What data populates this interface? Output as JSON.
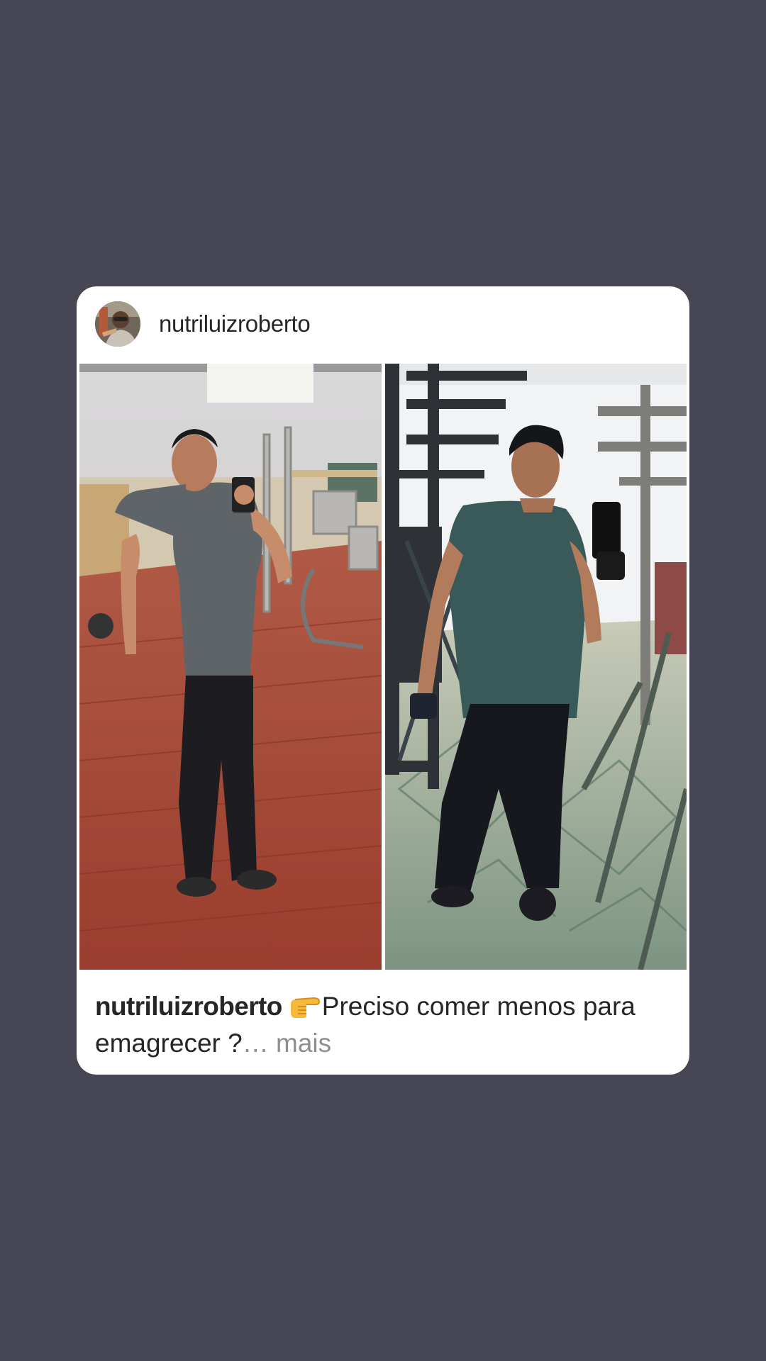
{
  "post": {
    "username": "nutriluizroberto",
    "avatar_icon": "profile-avatar",
    "media": {
      "before_photo_icon": "before-photo",
      "after_photo_icon": "after-photo"
    },
    "caption": {
      "username": "nutriluizroberto",
      "emoji": "pointing-right-icon",
      "text": "Preciso comer menos para emagrecer ?",
      "ellipsis": "…",
      "more_label": " mais"
    }
  },
  "colors": {
    "background": "#474654",
    "card": "#ffffff",
    "text": "#262626",
    "muted": "#8e8e8e"
  }
}
